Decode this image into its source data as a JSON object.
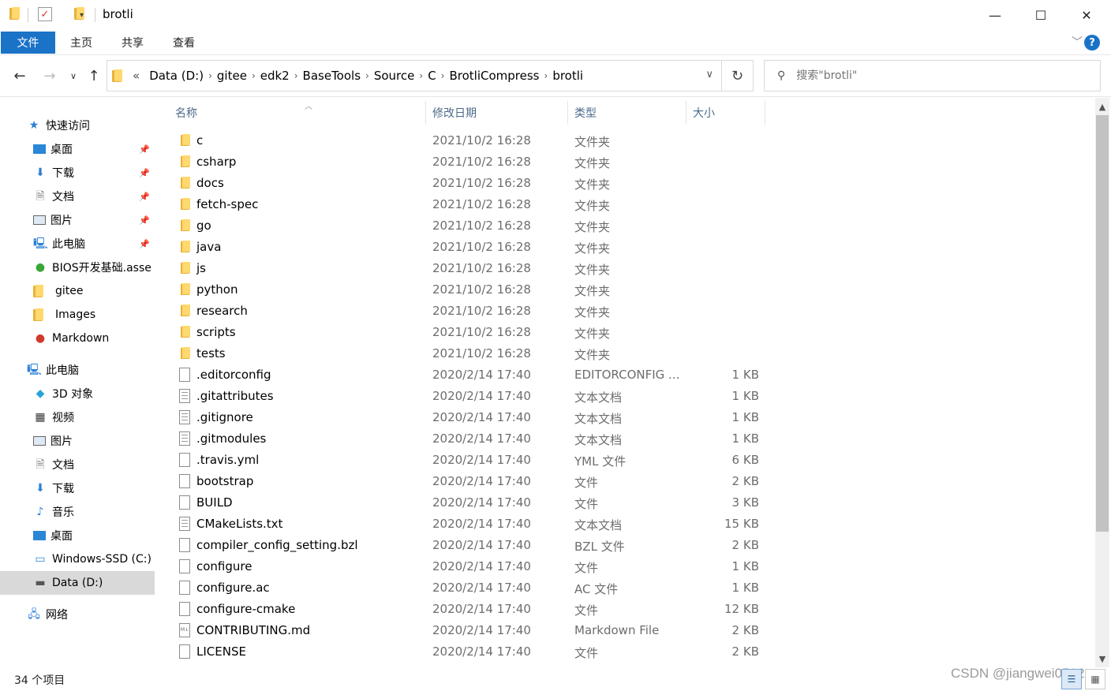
{
  "window": {
    "title": "brotli",
    "minimize": "—",
    "maximize": "☐",
    "close": "✕"
  },
  "ribbon": {
    "tabs": [
      {
        "label": "文件",
        "active": true
      },
      {
        "label": "主页"
      },
      {
        "label": "共享"
      },
      {
        "label": "查看"
      }
    ],
    "help": "?"
  },
  "address": {
    "overflow": "«",
    "breadcrumbs": [
      "Data (D:)",
      "gitee",
      "edk2",
      "BaseTools",
      "Source",
      "C",
      "BrotliCompress",
      "brotli"
    ]
  },
  "search": {
    "placeholder": "搜索\"brotli\""
  },
  "sidebar": {
    "quick_access": "快速访问",
    "quick_items": [
      "桌面",
      "下载",
      "文档",
      "图片",
      "此电脑",
      "BIOS开发基础.asse",
      "gitee",
      "Images",
      "Markdown"
    ],
    "this_pc": "此电脑",
    "pc_items": [
      "3D 对象",
      "视频",
      "图片",
      "文档",
      "下载",
      "音乐",
      "桌面",
      "Windows-SSD (C:)",
      "Data (D:)"
    ],
    "network": "网络"
  },
  "columns": {
    "name": "名称",
    "date": "修改日期",
    "type": "类型",
    "size": "大小"
  },
  "files": [
    {
      "name": "c",
      "date": "2021/10/2 16:28",
      "type": "文件夹",
      "size": "",
      "icon": "folder-icon"
    },
    {
      "name": "csharp",
      "date": "2021/10/2 16:28",
      "type": "文件夹",
      "size": "",
      "icon": "folder-icon"
    },
    {
      "name": "docs",
      "date": "2021/10/2 16:28",
      "type": "文件夹",
      "size": "",
      "icon": "folder-icon"
    },
    {
      "name": "fetch-spec",
      "date": "2021/10/2 16:28",
      "type": "文件夹",
      "size": "",
      "icon": "folder-icon"
    },
    {
      "name": "go",
      "date": "2021/10/2 16:28",
      "type": "文件夹",
      "size": "",
      "icon": "folder-icon"
    },
    {
      "name": "java",
      "date": "2021/10/2 16:28",
      "type": "文件夹",
      "size": "",
      "icon": "folder-icon"
    },
    {
      "name": "js",
      "date": "2021/10/2 16:28",
      "type": "文件夹",
      "size": "",
      "icon": "folder-icon"
    },
    {
      "name": "python",
      "date": "2021/10/2 16:28",
      "type": "文件夹",
      "size": "",
      "icon": "folder-icon"
    },
    {
      "name": "research",
      "date": "2021/10/2 16:28",
      "type": "文件夹",
      "size": "",
      "icon": "folder-icon"
    },
    {
      "name": "scripts",
      "date": "2021/10/2 16:28",
      "type": "文件夹",
      "size": "",
      "icon": "folder-icon"
    },
    {
      "name": "tests",
      "date": "2021/10/2 16:28",
      "type": "文件夹",
      "size": "",
      "icon": "folder-icon"
    },
    {
      "name": ".editorconfig",
      "date": "2020/2/14 17:40",
      "type": "EDITORCONFIG ...",
      "size": "1 KB",
      "icon": "file-icon"
    },
    {
      "name": ".gitattributes",
      "date": "2020/2/14 17:40",
      "type": "文本文档",
      "size": "1 KB",
      "icon": "text-file-icon"
    },
    {
      "name": ".gitignore",
      "date": "2020/2/14 17:40",
      "type": "文本文档",
      "size": "1 KB",
      "icon": "text-file-icon"
    },
    {
      "name": ".gitmodules",
      "date": "2020/2/14 17:40",
      "type": "文本文档",
      "size": "1 KB",
      "icon": "text-file-icon"
    },
    {
      "name": ".travis.yml",
      "date": "2020/2/14 17:40",
      "type": "YML 文件",
      "size": "6 KB",
      "icon": "file-icon"
    },
    {
      "name": "bootstrap",
      "date": "2020/2/14 17:40",
      "type": "文件",
      "size": "2 KB",
      "icon": "file-icon"
    },
    {
      "name": "BUILD",
      "date": "2020/2/14 17:40",
      "type": "文件",
      "size": "3 KB",
      "icon": "file-icon"
    },
    {
      "name": "CMakeLists.txt",
      "date": "2020/2/14 17:40",
      "type": "文本文档",
      "size": "15 KB",
      "icon": "text-file-icon"
    },
    {
      "name": "compiler_config_setting.bzl",
      "date": "2020/2/14 17:40",
      "type": "BZL 文件",
      "size": "2 KB",
      "icon": "file-icon"
    },
    {
      "name": "configure",
      "date": "2020/2/14 17:40",
      "type": "文件",
      "size": "1 KB",
      "icon": "file-icon"
    },
    {
      "name": "configure.ac",
      "date": "2020/2/14 17:40",
      "type": "AC 文件",
      "size": "1 KB",
      "icon": "file-icon"
    },
    {
      "name": "configure-cmake",
      "date": "2020/2/14 17:40",
      "type": "文件",
      "size": "12 KB",
      "icon": "file-icon"
    },
    {
      "name": "CONTRIBUTING.md",
      "date": "2020/2/14 17:40",
      "type": "Markdown File",
      "size": "2 KB",
      "icon": "markdown-file-icon"
    },
    {
      "name": "LICENSE",
      "date": "2020/2/14 17:40",
      "type": "文件",
      "size": "2 KB",
      "icon": "file-icon"
    }
  ],
  "status": {
    "count": "34 个项目"
  },
  "watermark": "CSDN @jiangwei0512"
}
